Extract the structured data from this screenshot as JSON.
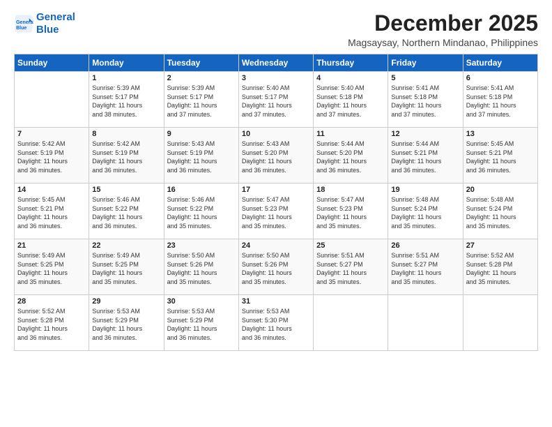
{
  "logo": {
    "line1": "General",
    "line2": "Blue"
  },
  "title": "December 2025",
  "location": "Magsaysay, Northern Mindanao, Philippines",
  "headers": [
    "Sunday",
    "Monday",
    "Tuesday",
    "Wednesday",
    "Thursday",
    "Friday",
    "Saturday"
  ],
  "weeks": [
    [
      {
        "day": "",
        "info": ""
      },
      {
        "day": "1",
        "info": "Sunrise: 5:39 AM\nSunset: 5:17 PM\nDaylight: 11 hours\nand 38 minutes."
      },
      {
        "day": "2",
        "info": "Sunrise: 5:39 AM\nSunset: 5:17 PM\nDaylight: 11 hours\nand 37 minutes."
      },
      {
        "day": "3",
        "info": "Sunrise: 5:40 AM\nSunset: 5:17 PM\nDaylight: 11 hours\nand 37 minutes."
      },
      {
        "day": "4",
        "info": "Sunrise: 5:40 AM\nSunset: 5:18 PM\nDaylight: 11 hours\nand 37 minutes."
      },
      {
        "day": "5",
        "info": "Sunrise: 5:41 AM\nSunset: 5:18 PM\nDaylight: 11 hours\nand 37 minutes."
      },
      {
        "day": "6",
        "info": "Sunrise: 5:41 AM\nSunset: 5:18 PM\nDaylight: 11 hours\nand 37 minutes."
      }
    ],
    [
      {
        "day": "7",
        "info": "Sunrise: 5:42 AM\nSunset: 5:19 PM\nDaylight: 11 hours\nand 36 minutes."
      },
      {
        "day": "8",
        "info": "Sunrise: 5:42 AM\nSunset: 5:19 PM\nDaylight: 11 hours\nand 36 minutes."
      },
      {
        "day": "9",
        "info": "Sunrise: 5:43 AM\nSunset: 5:19 PM\nDaylight: 11 hours\nand 36 minutes."
      },
      {
        "day": "10",
        "info": "Sunrise: 5:43 AM\nSunset: 5:20 PM\nDaylight: 11 hours\nand 36 minutes."
      },
      {
        "day": "11",
        "info": "Sunrise: 5:44 AM\nSunset: 5:20 PM\nDaylight: 11 hours\nand 36 minutes."
      },
      {
        "day": "12",
        "info": "Sunrise: 5:44 AM\nSunset: 5:21 PM\nDaylight: 11 hours\nand 36 minutes."
      },
      {
        "day": "13",
        "info": "Sunrise: 5:45 AM\nSunset: 5:21 PM\nDaylight: 11 hours\nand 36 minutes."
      }
    ],
    [
      {
        "day": "14",
        "info": "Sunrise: 5:45 AM\nSunset: 5:21 PM\nDaylight: 11 hours\nand 36 minutes."
      },
      {
        "day": "15",
        "info": "Sunrise: 5:46 AM\nSunset: 5:22 PM\nDaylight: 11 hours\nand 36 minutes."
      },
      {
        "day": "16",
        "info": "Sunrise: 5:46 AM\nSunset: 5:22 PM\nDaylight: 11 hours\nand 35 minutes."
      },
      {
        "day": "17",
        "info": "Sunrise: 5:47 AM\nSunset: 5:23 PM\nDaylight: 11 hours\nand 35 minutes."
      },
      {
        "day": "18",
        "info": "Sunrise: 5:47 AM\nSunset: 5:23 PM\nDaylight: 11 hours\nand 35 minutes."
      },
      {
        "day": "19",
        "info": "Sunrise: 5:48 AM\nSunset: 5:24 PM\nDaylight: 11 hours\nand 35 minutes."
      },
      {
        "day": "20",
        "info": "Sunrise: 5:48 AM\nSunset: 5:24 PM\nDaylight: 11 hours\nand 35 minutes."
      }
    ],
    [
      {
        "day": "21",
        "info": "Sunrise: 5:49 AM\nSunset: 5:25 PM\nDaylight: 11 hours\nand 35 minutes."
      },
      {
        "day": "22",
        "info": "Sunrise: 5:49 AM\nSunset: 5:25 PM\nDaylight: 11 hours\nand 35 minutes."
      },
      {
        "day": "23",
        "info": "Sunrise: 5:50 AM\nSunset: 5:26 PM\nDaylight: 11 hours\nand 35 minutes."
      },
      {
        "day": "24",
        "info": "Sunrise: 5:50 AM\nSunset: 5:26 PM\nDaylight: 11 hours\nand 35 minutes."
      },
      {
        "day": "25",
        "info": "Sunrise: 5:51 AM\nSunset: 5:27 PM\nDaylight: 11 hours\nand 35 minutes."
      },
      {
        "day": "26",
        "info": "Sunrise: 5:51 AM\nSunset: 5:27 PM\nDaylight: 11 hours\nand 35 minutes."
      },
      {
        "day": "27",
        "info": "Sunrise: 5:52 AM\nSunset: 5:28 PM\nDaylight: 11 hours\nand 35 minutes."
      }
    ],
    [
      {
        "day": "28",
        "info": "Sunrise: 5:52 AM\nSunset: 5:28 PM\nDaylight: 11 hours\nand 36 minutes."
      },
      {
        "day": "29",
        "info": "Sunrise: 5:53 AM\nSunset: 5:29 PM\nDaylight: 11 hours\nand 36 minutes."
      },
      {
        "day": "30",
        "info": "Sunrise: 5:53 AM\nSunset: 5:29 PM\nDaylight: 11 hours\nand 36 minutes."
      },
      {
        "day": "31",
        "info": "Sunrise: 5:53 AM\nSunset: 5:30 PM\nDaylight: 11 hours\nand 36 minutes."
      },
      {
        "day": "",
        "info": ""
      },
      {
        "day": "",
        "info": ""
      },
      {
        "day": "",
        "info": ""
      }
    ]
  ]
}
